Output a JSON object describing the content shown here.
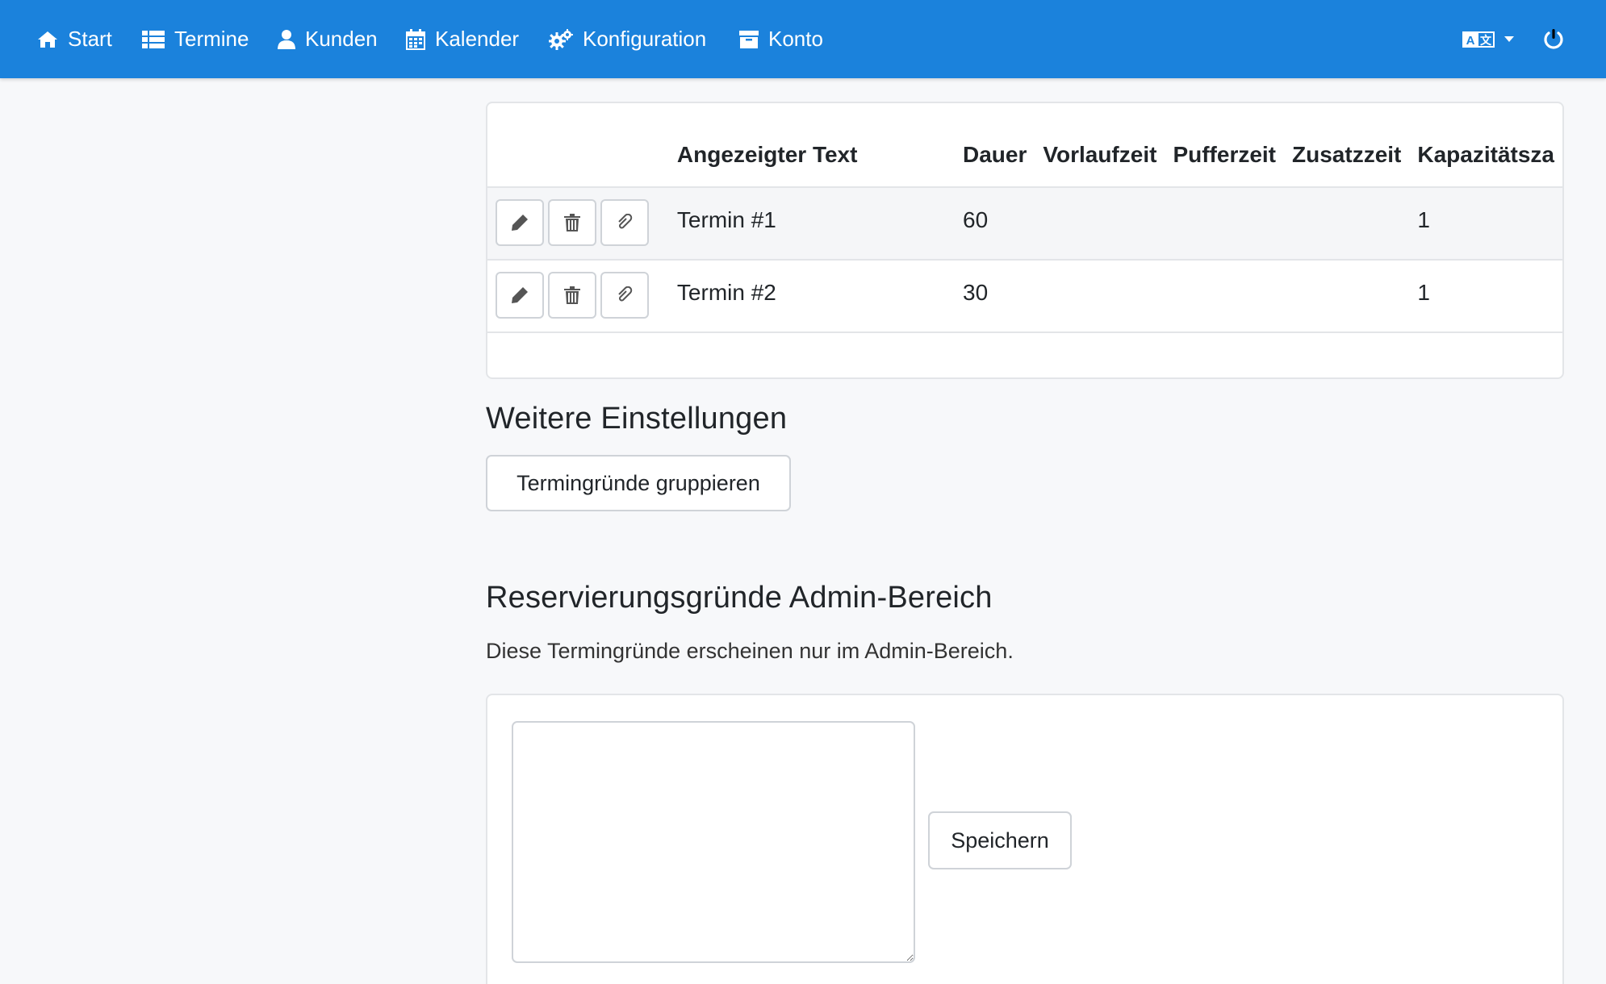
{
  "navbar": {
    "items": [
      {
        "label": "Start",
        "icon": "home-icon"
      },
      {
        "label": "Termine",
        "icon": "list-icon"
      },
      {
        "label": "Kunden",
        "icon": "user-icon"
      },
      {
        "label": "Kalender",
        "icon": "calendar-icon"
      },
      {
        "label": "Konfiguration",
        "icon": "gears-icon"
      },
      {
        "label": "Konto",
        "icon": "archive-icon"
      }
    ],
    "right": [
      {
        "icon": "language-icon"
      },
      {
        "icon": "power-icon"
      }
    ]
  },
  "reasons_table": {
    "columns": [
      "",
      "Angezeigter Text",
      "Dauer",
      "Vorlaufzeit",
      "Pufferzeit",
      "Zusatzzeit",
      "Kapazitätsza"
    ],
    "rows": [
      {
        "text": "Termin #1",
        "dauer": "60",
        "vorlaufzeit": "",
        "pufferzeit": "",
        "zusatzzeit": "",
        "kapazitaet": "1"
      },
      {
        "text": "Termin #2",
        "dauer": "30",
        "vorlaufzeit": "",
        "pufferzeit": "",
        "zusatzzeit": "",
        "kapazitaet": "1"
      }
    ],
    "row_actions": [
      "edit-icon",
      "trash-icon",
      "paperclip-icon"
    ]
  },
  "further_settings": {
    "heading": "Weitere Einstellungen",
    "group_button": "Termingründe gruppieren"
  },
  "admin_reasons": {
    "heading": "Reservierungsgründe Admin-Bereich",
    "description": "Diese Termingründe erscheinen nur im Admin-Bereich.",
    "textarea_value": "",
    "save_button": "Speichern"
  }
}
